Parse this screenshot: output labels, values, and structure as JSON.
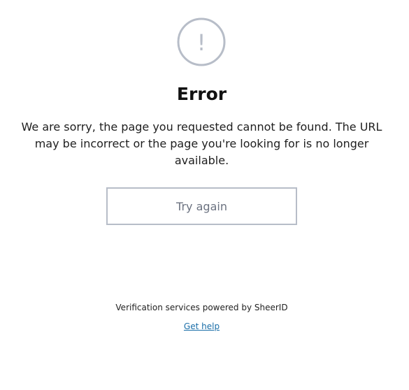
{
  "icon": {
    "name": "exclamation-circle-icon",
    "symbol": "!",
    "color": "#b7bdc8"
  },
  "error": {
    "title": "Error",
    "message": "We are sorry, the page you requested cannot be found. The URL may be incorrect or the page you're looking for is no longer available."
  },
  "actions": {
    "try_again_label": "Try again"
  },
  "footer": {
    "powered_by": "Verification services powered by SheerID",
    "help_label": "Get help"
  },
  "colors": {
    "button_border": "#b7bdc8",
    "link": "#1a6ea8"
  }
}
